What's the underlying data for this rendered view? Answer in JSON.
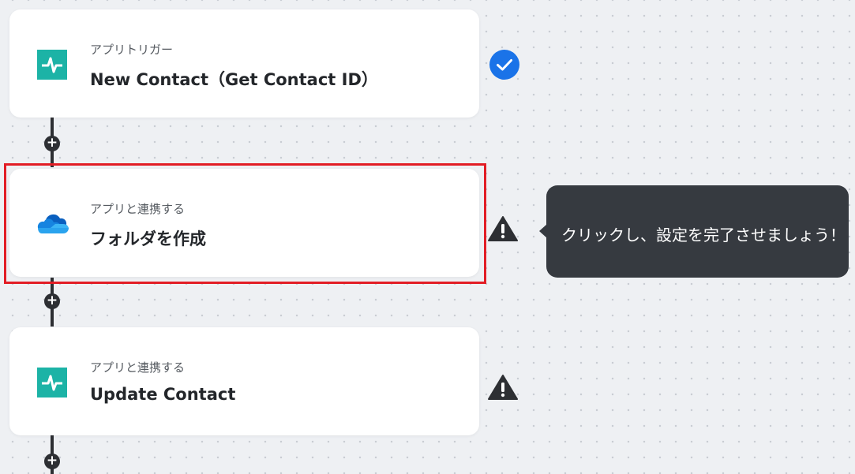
{
  "steps": [
    {
      "subtitle": "アプリトリガー",
      "title": "New Contact（Get Contact ID）",
      "app_icon": "hubspot-like-teal-icon",
      "status": "complete"
    },
    {
      "subtitle": "アプリと連携する",
      "title": "フォルダを作成",
      "app_icon": "onedrive-cloud-icon",
      "status": "warning"
    },
    {
      "subtitle": "アプリと連携する",
      "title": "Update Contact",
      "app_icon": "hubspot-like-teal-icon",
      "status": "warning"
    }
  ],
  "tooltip": {
    "text": "クリックし、設定を完了させましょう！"
  },
  "add_step_symbol": "+",
  "colors": {
    "teal": "#1cb3a6",
    "check_blue": "#1a73e8",
    "highlight_red": "#e21d25",
    "tooltip_bg": "#363a40",
    "warn_dark": "#2d2f33"
  }
}
